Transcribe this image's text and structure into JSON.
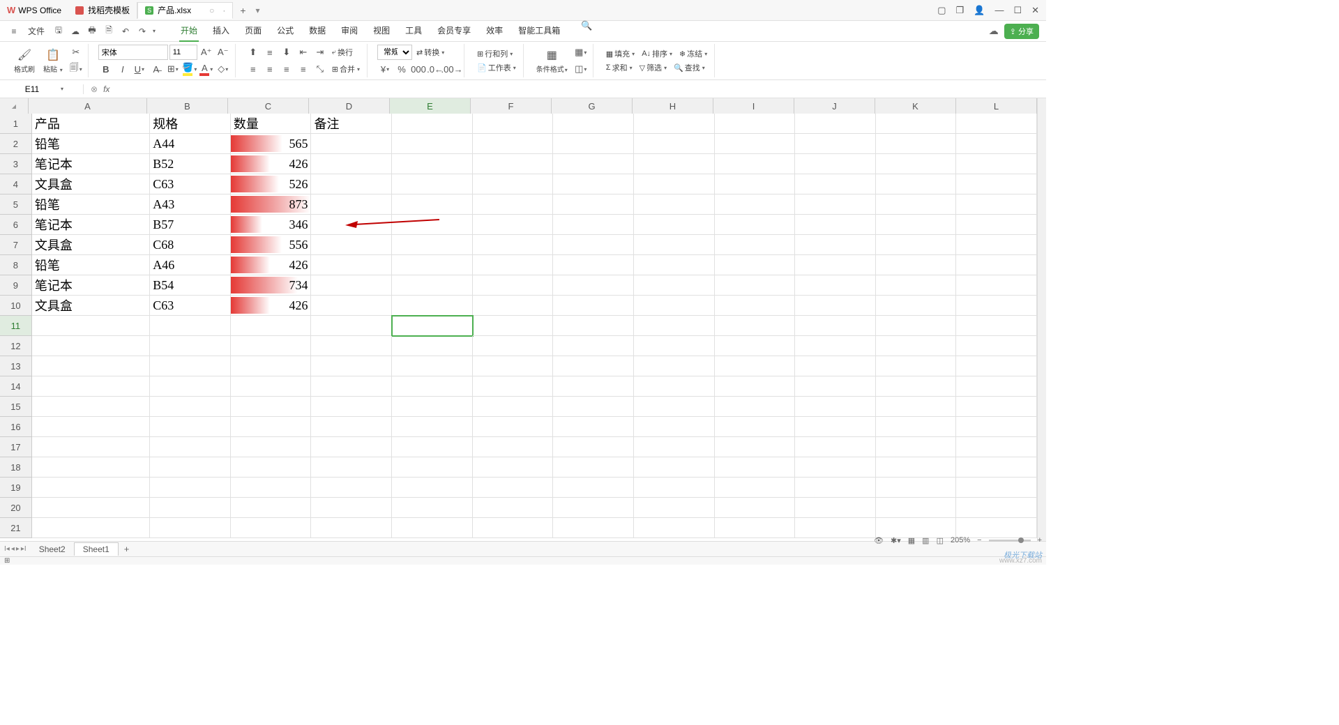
{
  "app": {
    "name": "WPS Office"
  },
  "tabs": [
    {
      "icon": "red",
      "label": "找稻壳模板"
    },
    {
      "icon": "green",
      "iconText": "S",
      "label": "产品.xlsx",
      "active": true
    }
  ],
  "menu": {
    "file": "文件",
    "items": [
      "开始",
      "插入",
      "页面",
      "公式",
      "数据",
      "审阅",
      "视图",
      "工具",
      "会员专享",
      "效率",
      "智能工具箱"
    ],
    "active": "开始",
    "share": "分享"
  },
  "ribbon": {
    "format_painter": "格式刷",
    "paste": "粘贴",
    "font_name": "宋体",
    "font_size": "11",
    "wrap": "换行",
    "merge": "合并",
    "general": "常规",
    "convert": "转换",
    "row_col": "行和列",
    "worksheet": "工作表",
    "cond_fmt": "条件格式",
    "fill": "填充",
    "sort": "排序",
    "freeze": "冻结",
    "sum": "求和",
    "filter": "筛选",
    "find": "查找"
  },
  "name_box": "E11",
  "columns": [
    "A",
    "B",
    "C",
    "D",
    "E",
    "F",
    "G",
    "H",
    "I",
    "J",
    "K",
    "L"
  ],
  "active_col": "E",
  "active_row": 11,
  "headers": {
    "A": "产品",
    "B": "规格",
    "C": "数量",
    "D": "备注"
  },
  "chart_data": {
    "type": "table",
    "columns": [
      "产品",
      "规格",
      "数量",
      "备注"
    ],
    "rows": [
      {
        "产品": "铅笔",
        "规格": "A44",
        "数量": 565
      },
      {
        "产品": "笔记本",
        "规格": "B52",
        "数量": 426
      },
      {
        "产品": "文具盒",
        "规格": "C63",
        "数量": 526
      },
      {
        "产品": "铅笔",
        "规格": "A43",
        "数量": 873
      },
      {
        "产品": "笔记本",
        "规格": "B57",
        "数量": 346
      },
      {
        "产品": "文具盒",
        "规格": "C68",
        "数量": 556
      },
      {
        "产品": "铅笔",
        "规格": "A46",
        "数量": 426
      },
      {
        "产品": "笔记本",
        "规格": "B54",
        "数量": 734
      },
      {
        "产品": "文具盒",
        "规格": "C63",
        "数量": 426
      }
    ],
    "databar_column": "数量",
    "databar_max": 873
  },
  "sheets": {
    "list": [
      "Sheet2",
      "Sheet1"
    ],
    "active": "Sheet1"
  },
  "zoom": "205%",
  "watermark": "极光下载站",
  "watermark_url": "www.xz7.com"
}
